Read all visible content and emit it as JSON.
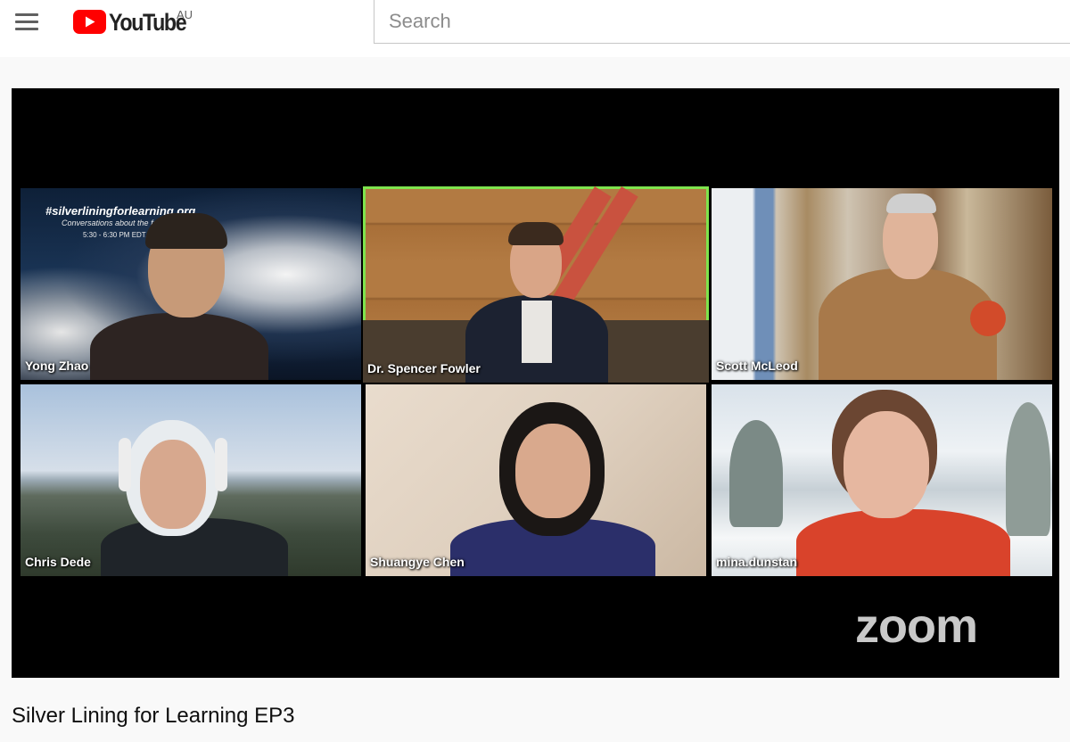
{
  "header": {
    "logo_text": "YouTube",
    "region": "AU",
    "search_placeholder": "Search"
  },
  "player": {
    "app_watermark": "zoom",
    "participants": [
      {
        "name": "Yong Zhao",
        "speaking": false
      },
      {
        "name": "Dr. Spencer Fowler",
        "speaking": true
      },
      {
        "name": "Scott McLeod",
        "speaking": false
      },
      {
        "name": "Chris Dede",
        "speaking": false
      },
      {
        "name": "Shuangye Chen",
        "speaking": false
      },
      {
        "name": "mina.dunstan",
        "speaking": false
      }
    ],
    "backdrop_lines": [
      "#silverliningforlearning.org",
      "Conversations about the future of ed",
      "5:30 - 6:30 PM EDT, Satur"
    ]
  },
  "video": {
    "title": "Silver Lining for Learning EP3"
  },
  "colors": {
    "brand_red": "#ff0000",
    "active_speaker": "#7ee44d",
    "player_bg": "#000000",
    "page_bg": "#f9f9f9"
  },
  "icons": [
    "hamburger-menu-icon",
    "youtube-play-icon"
  ]
}
